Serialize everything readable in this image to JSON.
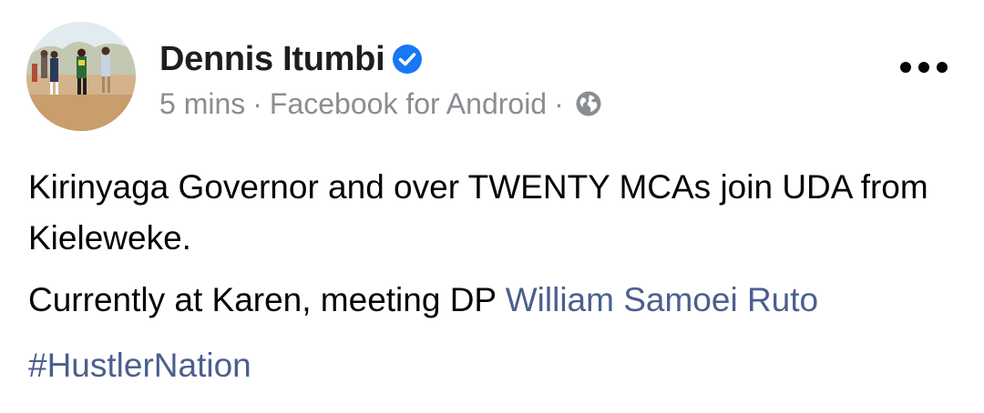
{
  "author": {
    "name": "Dennis Itumbi",
    "verified_icon": "verified-badge-icon",
    "verified_color": "#1877f2"
  },
  "meta": {
    "time": "5 mins",
    "separator": "·",
    "source": "Facebook for Android",
    "audience_icon": "globe-icon"
  },
  "more_icon": "more-options-icon",
  "post": {
    "line1": "Kirinyaga Governor and over TWENTY MCAs join UDA from Kieleweke.",
    "line2_prefix": "Currently at Karen, meeting DP ",
    "line2_mention": "William Samoei Ruto",
    "hashtag": "#HustlerNation"
  },
  "colors": {
    "text": "#050505",
    "meta": "#8a8d91",
    "link": "#4b5f8e"
  }
}
